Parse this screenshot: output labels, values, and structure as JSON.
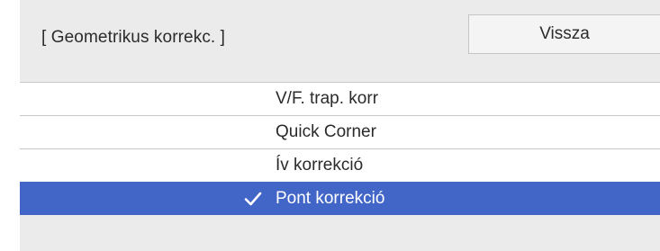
{
  "header": {
    "title": "[ Geometrikus korrekc. ]",
    "back_label": "Vissza"
  },
  "menu": {
    "items": [
      {
        "label": "V/F. trap. korr",
        "selected": false
      },
      {
        "label": "Quick Corner",
        "selected": false
      },
      {
        "label": "Ív korrekció",
        "selected": false
      },
      {
        "label": "Pont korrekció",
        "selected": true
      }
    ]
  },
  "colors": {
    "selected_bg": "#4266c8",
    "panel_bg": "#ebebeb"
  },
  "icons": {
    "selected_marker": "checkmark-icon"
  }
}
